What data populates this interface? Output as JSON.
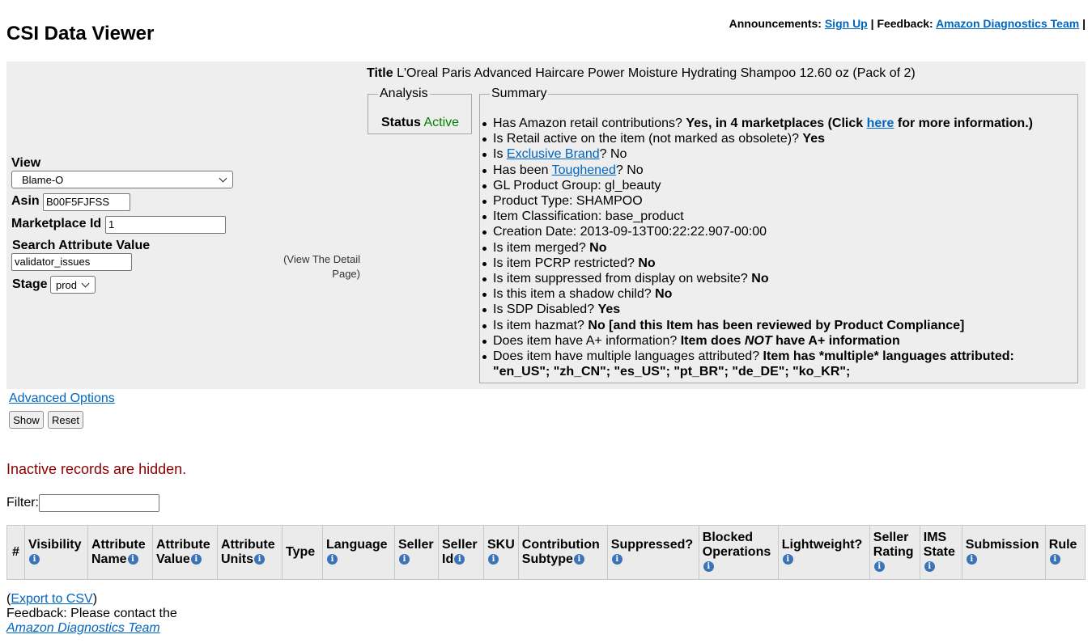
{
  "header": {
    "title": "CSI Data Viewer",
    "announcements_label": "Announcements:",
    "signup_link": "Sign Up",
    "sep1": "|",
    "feedback_label": "Feedback:",
    "feedback_link": "Amazon Diagnostics Team",
    "sep2": "|"
  },
  "form": {
    "view_label": "View",
    "view_value": "Blame-O",
    "asin_label": "Asin",
    "asin_value": "B00F5FJFSS",
    "marketplace_label": "Marketplace Id",
    "marketplace_value": "1",
    "search_label": "Search Attribute Value",
    "search_value": "validator_issues",
    "stage_label": "Stage",
    "stage_value": "prod",
    "detail_link_line1": "(View The Detail",
    "detail_link_line2": "Page)"
  },
  "item": {
    "title_label": "Title",
    "title_value": "L'Oreal Paris Advanced Haircare Power Moisture Hydrating Shampoo 12.60 oz (Pack of 2)"
  },
  "analysis": {
    "legend": "Analysis",
    "status_label": "Status",
    "status_value": "Active",
    "status_color": "#008000"
  },
  "summary": {
    "legend": "Summary",
    "retail_q": "Has Amazon retail contributions?",
    "retail_a": "Yes, in 4 marketplaces (Click",
    "retail_link": "here",
    "retail_a2": "for more information.)",
    "active_q": "Is Retail active on the item (not marked as obsolete)?",
    "active_a": "Yes",
    "excl_pre": "Is",
    "excl_link": "Exclusive Brand",
    "excl_post": "? No",
    "tough_pre": "Has been",
    "tough_link": "Toughened",
    "tough_post": "? No",
    "gl": "GL Product Group: gl_beauty",
    "ptype": "Product Type: SHAMPOO",
    "iclass": "Item Classification: base_product",
    "cdate": "Creation Date: 2013-09-13T00:22:22.907-00:00",
    "merged_q": "Is item merged?",
    "merged_a": "No",
    "pcrp_q": "Is item PCRP restricted?",
    "pcrp_a": "No",
    "supp_q": "Is item suppressed from display on website?",
    "supp_a": "No",
    "shadow_q": "Is this item a shadow child?",
    "shadow_a": "No",
    "sdp_q": "Is SDP Disabled?",
    "sdp_a": "Yes",
    "hazmat_q": "Is item hazmat?",
    "hazmat_a": "No [and this Item has been reviewed by Product Compliance]",
    "aplus_q": "Does item have A+ information?",
    "aplus_a1": "Item does",
    "aplus_not": "NOT",
    "aplus_a2": "have A+ information",
    "lang_q": "Does item have multiple languages attributed?",
    "lang_a1": "Item has *multiple* languages attributed:",
    "lang_a2": "\"en_US\"; \"zh_CN\"; \"es_US\"; \"pt_BR\"; \"de_DE\"; \"ko_KR\";"
  },
  "controls": {
    "advanced_link": "Advanced Options",
    "show_button": "Show",
    "reset_button": "Reset"
  },
  "notice": {
    "inactive_text": "Inactive records are hidden.",
    "filter_label": "Filter:",
    "filter_value": ""
  },
  "table": {
    "info_glyph": "i",
    "headers": {
      "num": "#",
      "visibility": "Visibility",
      "attr_name_1": "Attribute",
      "attr_name_2": "Name",
      "attr_value_1": "Attribute",
      "attr_value_2": "Value",
      "attr_units_1": "Attribute",
      "attr_units_2": "Units",
      "type": "Type",
      "language": "Language",
      "seller": "Seller",
      "seller_id_1": "Seller",
      "seller_id_2": "Id",
      "sku": "SKU",
      "contrib_1": "Contribution",
      "contrib_2": "Subtype",
      "suppressed": "Suppressed?",
      "blocked_1": "Blocked",
      "blocked_2": "Operations",
      "lightweight": "Lightweight?",
      "rating_1": "Seller",
      "rating_2": "Rating",
      "ims_1": "IMS",
      "ims_2": "State",
      "submission": "Submission",
      "rule": "Rule"
    }
  },
  "footer": {
    "export_open": "(",
    "export_link": "Export to CSV",
    "export_close": ")",
    "feedback_text": "Feedback: Please contact the",
    "team_link": "Amazon Diagnostics Team"
  }
}
